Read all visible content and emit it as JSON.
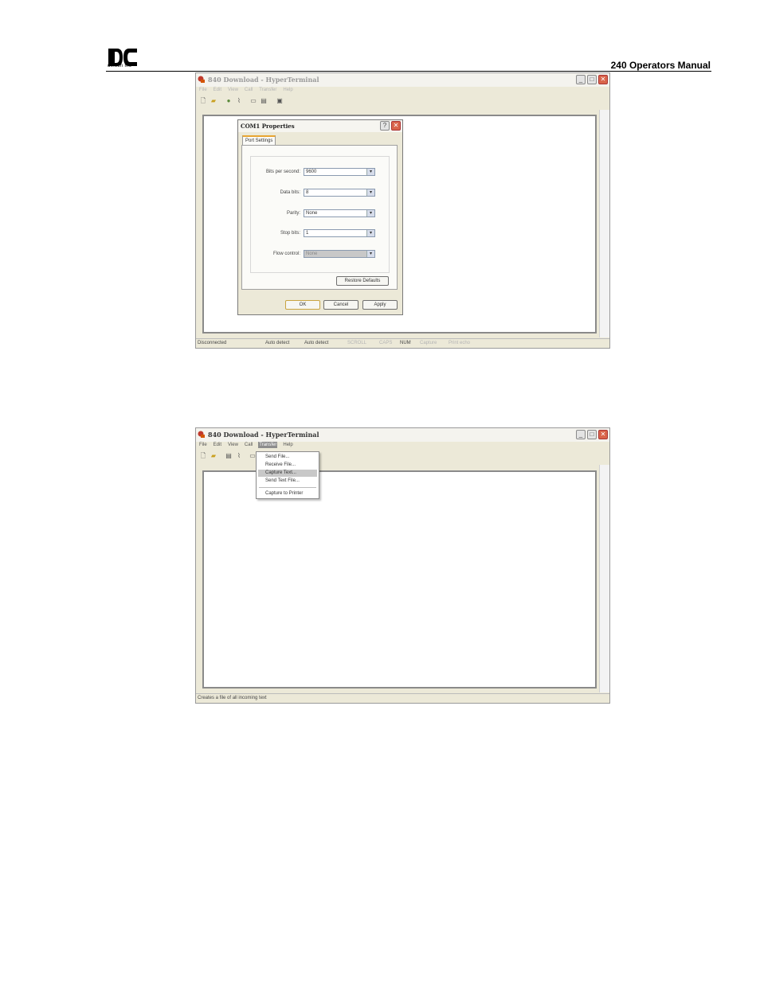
{
  "header": {
    "logo_text": "delcon inc",
    "doc_title": "240 Operators Manual"
  },
  "colors": {
    "window_bg": "#ece9d8",
    "close_button": "#d9644a",
    "menu_highlight": "#c8c8c8"
  },
  "window1": {
    "title": "840 Download - HyperTerminal",
    "menu": [
      "File",
      "Edit",
      "View",
      "Call",
      "Transfer",
      "Help"
    ],
    "dialog": {
      "title": "COM1 Properties",
      "tab": "Port Settings",
      "fields": [
        {
          "label": "Bits per second:",
          "value": "9600"
        },
        {
          "label": "Data bits:",
          "value": "8"
        },
        {
          "label": "Parity:",
          "value": "None"
        },
        {
          "label": "Stop bits:",
          "value": "1"
        },
        {
          "label": "Flow control:",
          "value": "None"
        }
      ],
      "restore_defaults": "Restore Defaults",
      "ok": "OK",
      "cancel": "Cancel",
      "apply": "Apply",
      "help_glyph": "?",
      "close_glyph": "✕"
    },
    "status": {
      "connection": "Disconnected",
      "auto_detect_1": "Auto detect",
      "auto_detect_2": "Auto detect",
      "scroll": "SCROLL",
      "caps": "CAPS",
      "num": "NUM",
      "capture": "Capture",
      "print_echo": "Print echo"
    }
  },
  "window2": {
    "title": "840 Download - HyperTerminal",
    "menu": [
      "File",
      "Edit",
      "View",
      "Call",
      "Transfer",
      "Help"
    ],
    "transfer_menu": {
      "items": [
        "Send File...",
        "Receive File...",
        "Capture Text...",
        "Send Text File...",
        "Capture to Printer"
      ],
      "highlighted": "Capture Text..."
    },
    "status_text": "Creates a file of all incoming text"
  }
}
